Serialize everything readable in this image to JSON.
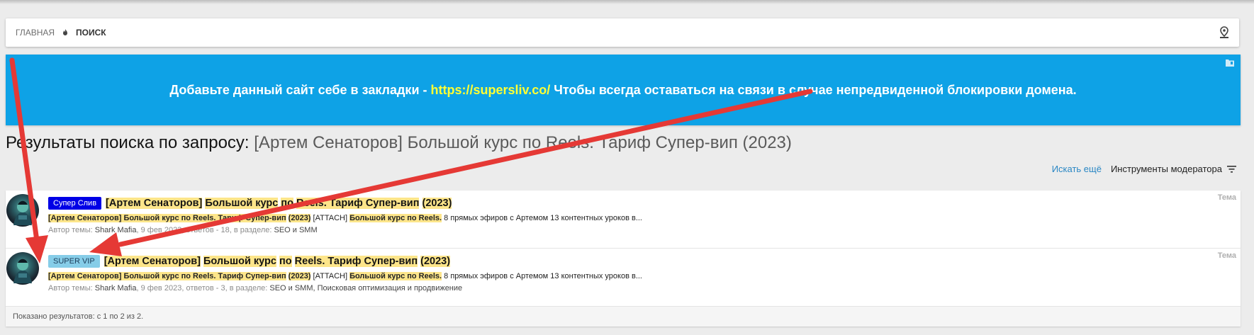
{
  "breadcrumb": {
    "home": "Главная",
    "current": "Поиск"
  },
  "notice": {
    "prefix": "Добавьте данный сайт себе в закладки -",
    "link": "https://supersliv.co/",
    "suffix": "Чтобы всегда оставаться на связи в случае непредвиденной блокировки домена."
  },
  "search": {
    "heading_prefix": "Результаты поиска по запросу:",
    "query": "[Артем Сенаторов] Большой курс по Reels. Тариф Супер-вип (2023)",
    "more_label": "Искать ещё",
    "mod_tools_label": "Инструменты модератора"
  },
  "results": [
    {
      "badge": "Супер Слив",
      "type": "Тема",
      "title": [
        "[Артем Сенаторов]",
        "Большой курс",
        "по",
        "Reels. Тариф Супер-вип",
        "(2023)"
      ],
      "snippet_hl": [
        "[Артем Сенаторов] Большой курс по Reels. Тариф Супер-вип",
        "(2023)"
      ],
      "snippet_mid": "[ATTACH]",
      "snippet_hl2": "Большой курс по Reels.",
      "snippet_tail": "8 прямых эфиров с Артемом 13 контентных уроков в...",
      "meta_author_label": "Автор темы:",
      "meta_author": "Shark Mafia",
      "meta_date": "9 фев 2023",
      "meta_replies": "ответов - 18",
      "meta_section_label": "в разделе:",
      "meta_section": "SEO и SMM"
    },
    {
      "badge": "SUPER VIP",
      "type": "Тема",
      "title": [
        "[Артем Сенаторов]",
        "Большой курс",
        "по",
        "Reels. Тариф Супер-вип",
        "(2023)"
      ],
      "snippet_hl": [
        "[Артем Сенаторов] Большой курс по Reels. Тариф Супер-вип",
        "(2023)"
      ],
      "snippet_mid": "[ATTACH]",
      "snippet_hl2": "Большой курс по Reels.",
      "snippet_tail": "8 прямых эфиров с Артемом 13 контентных уроков в...",
      "meta_author_label": "Автор темы:",
      "meta_author": "Shark Mafia",
      "meta_date": "9 фев 2023",
      "meta_replies": "ответов - 3",
      "meta_section_label": "в разделе:",
      "meta_section": "SEO и SMM, Поисковая оптимизация и продвижение"
    }
  ],
  "footer": "Показано результатов: с 1 по 2 из 2.",
  "colors": {
    "notice_bg": "#0ea2e6",
    "link": "#ffff33",
    "highlight": "#fde58a",
    "arrow": "#e53935"
  }
}
